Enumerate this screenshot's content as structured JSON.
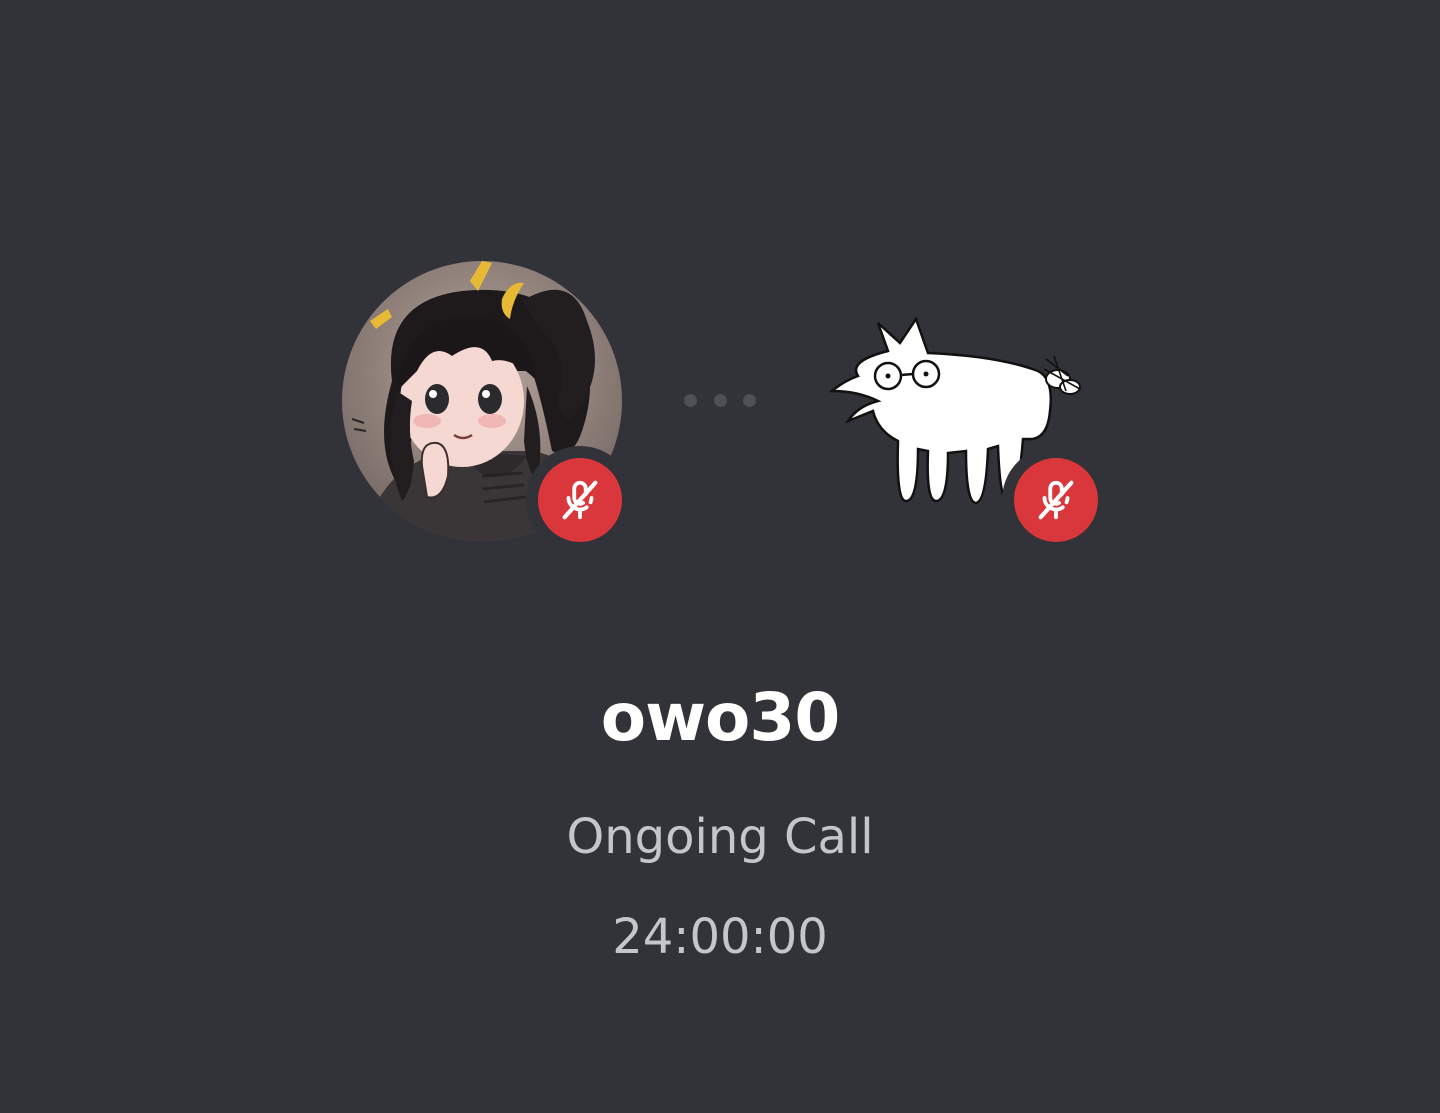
{
  "call": {
    "username": "owo30",
    "status": "Ongoing Call",
    "duration": "24:00:00"
  },
  "participants": [
    {
      "avatar": "anime-girl-avatar",
      "muted": true,
      "badge_icon": "mic-muted-icon"
    },
    {
      "avatar": "white-dog-drawing-avatar",
      "muted": true,
      "badge_icon": "mic-muted-icon"
    }
  ],
  "colors": {
    "background": "#313338",
    "muted_badge": "#da373c",
    "text_primary": "#ffffff",
    "text_secondary": "#c4c6cc",
    "dots": "#4e5058"
  }
}
